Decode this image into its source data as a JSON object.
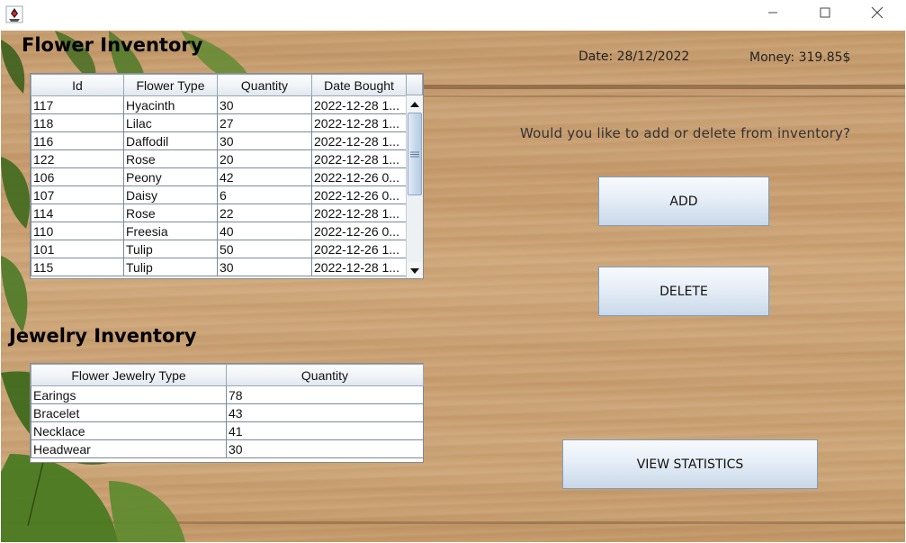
{
  "window": {
    "icon": "java-duke-icon",
    "controls": [
      "minimize-icon",
      "maximize-icon",
      "close-icon"
    ]
  },
  "flower_section": {
    "title": "Flower Inventory",
    "columns": [
      "Id",
      "Flower Type",
      "Quantity",
      "Date Bought"
    ],
    "rows": [
      [
        "117",
        "Hyacinth",
        "30",
        "2022-12-28 1..."
      ],
      [
        "118",
        "Lilac",
        "27",
        "2022-12-28 1..."
      ],
      [
        "116",
        "Daffodil",
        "30",
        "2022-12-28 1..."
      ],
      [
        "122",
        "Rose",
        "20",
        "2022-12-28 1..."
      ],
      [
        "106",
        "Peony",
        "42",
        "2022-12-26 0..."
      ],
      [
        "107",
        "Daisy",
        "6",
        "2022-12-26 0..."
      ],
      [
        "114",
        "Rose",
        "22",
        "2022-12-28 1..."
      ],
      [
        "110",
        "Freesia",
        "40",
        "2022-12-26 0..."
      ],
      [
        "101",
        "Tulip",
        "50",
        "2022-12-26 1..."
      ],
      [
        "115",
        "Tulip",
        "30",
        "2022-12-28 1..."
      ]
    ]
  },
  "jewelry_section": {
    "title": "Jewelry Inventory",
    "columns": [
      "Flower Jewelry Type",
      "Quantity"
    ],
    "rows": [
      [
        "Earings",
        "78"
      ],
      [
        "Bracelet",
        "43"
      ],
      [
        "Necklace",
        "41"
      ],
      [
        "Headwear",
        "30"
      ]
    ]
  },
  "header_info": {
    "date": "Date: 28/12/2022",
    "money": "Money: 319.85$"
  },
  "prompt": {
    "question": "Would you like to add or delete from inventory?"
  },
  "buttons": {
    "add": "ADD",
    "delete": "DELETE",
    "stats": "VIEW STATISTICS"
  },
  "colors": {
    "wood": "#c9a072",
    "button_top": "#f7fafd",
    "button_bottom": "#c9d8e9",
    "button_border": "#7f9db9",
    "leaf": "#3f6a1e"
  }
}
